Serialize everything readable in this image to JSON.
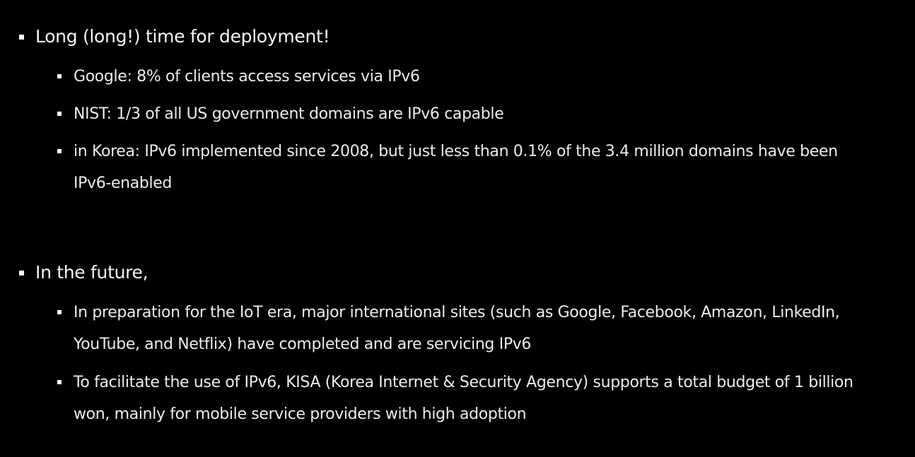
{
  "slide": {
    "sections": [
      {
        "heading": "Long (long!) time for deployment!",
        "items": [
          "Google: 8% of clients access services via IPv6",
          "NIST: 1/3 of all US government domains are IPv6 capable",
          "in Korea: IPv6 implemented since 2008, but just less than 0.1% of the 3.4 million domains have been IPv6-enabled"
        ]
      },
      {
        "heading": "In the future,",
        "items": [
          "In preparation for the IoT era, major international sites (such as Google, Facebook, Amazon, LinkedIn, YouTube, and Netflix) have completed and are servicing IPv6",
          "To facilitate the use of IPv6, KISA (Korea Internet & Security Agency) supports a total budget of 1 billion won, mainly for mobile service providers with high adoption"
        ]
      }
    ]
  }
}
